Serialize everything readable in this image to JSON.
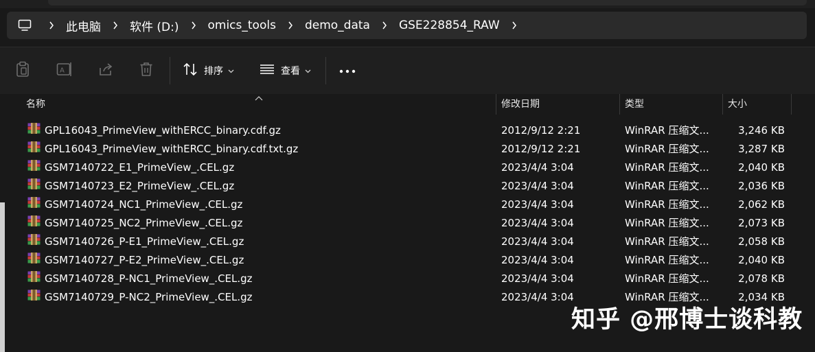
{
  "breadcrumb": {
    "items": [
      "此电脑",
      "软件 (D:)",
      "omics_tools",
      "demo_data",
      "GSE228854_RAW"
    ]
  },
  "toolbar": {
    "sort_label": "排序",
    "view_label": "查看",
    "more_label": "..."
  },
  "columns": {
    "name": "名称",
    "date": "修改日期",
    "type": "类型",
    "size": "大小"
  },
  "files": [
    {
      "name": "GPL16043_PrimeView_withERCC_binary.cdf.gz",
      "date": "2012/9/12 2:21",
      "type": "WinRAR 压缩文...",
      "size": "3,246 KB"
    },
    {
      "name": "GPL16043_PrimeView_withERCC_binary.cdf.txt.gz",
      "date": "2012/9/12 2:21",
      "type": "WinRAR 压缩文...",
      "size": "3,287 KB"
    },
    {
      "name": "GSM7140722_E1_PrimeView_.CEL.gz",
      "date": "2023/4/4 3:04",
      "type": "WinRAR 压缩文...",
      "size": "2,040 KB"
    },
    {
      "name": "GSM7140723_E2_PrimeView_.CEL.gz",
      "date": "2023/4/4 3:04",
      "type": "WinRAR 压缩文...",
      "size": "2,036 KB"
    },
    {
      "name": "GSM7140724_NC1_PrimeView_.CEL.gz",
      "date": "2023/4/4 3:04",
      "type": "WinRAR 压缩文...",
      "size": "2,062 KB"
    },
    {
      "name": "GSM7140725_NC2_PrimeView_.CEL.gz",
      "date": "2023/4/4 3:04",
      "type": "WinRAR 压缩文...",
      "size": "2,073 KB"
    },
    {
      "name": "GSM7140726_P-E1_PrimeView_.CEL.gz",
      "date": "2023/4/4 3:04",
      "type": "WinRAR 压缩文...",
      "size": "2,058 KB"
    },
    {
      "name": "GSM7140727_P-E2_PrimeView_.CEL.gz",
      "date": "2023/4/4 3:04",
      "type": "WinRAR 压缩文...",
      "size": "2,040 KB"
    },
    {
      "name": "GSM7140728_P-NC1_PrimeView_.CEL.gz",
      "date": "2023/4/4 3:04",
      "type": "WinRAR 压缩文...",
      "size": "2,078 KB"
    },
    {
      "name": "GSM7140729_P-NC2_PrimeView_.CEL.gz",
      "date": "2023/4/4 3:04",
      "type": "WinRAR 压缩文...",
      "size": "2,034 KB"
    }
  ],
  "watermark": "知乎 @邢博士谈科教",
  "colors": {
    "background": "#191919",
    "address_bar": "#2b2b2b",
    "toolbar": "#1f1f1f",
    "disabled_icon": "#6e6e6e",
    "accent": "#4cc2ff"
  },
  "icons": {
    "pc": "computer-icon",
    "sep": "chevron-right-icon",
    "copy": "clipboard-icon",
    "rename": "rename-icon",
    "share": "share-icon",
    "delete": "trash-icon",
    "sort": "sort-icon",
    "view": "view-list-icon",
    "more": "more-icon",
    "file": "winrar-archive-icon"
  }
}
